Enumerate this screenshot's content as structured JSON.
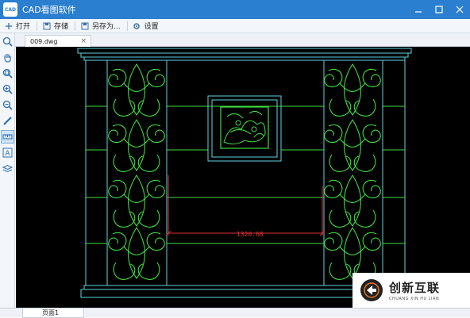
{
  "window": {
    "title": "CAD看图软件",
    "logo_text": "CAD",
    "minimize_icon": "minimize-icon",
    "maximize_icon": "maximize-icon",
    "close_icon": "close-icon"
  },
  "toolbar": {
    "items": [
      {
        "label": "打开",
        "icon": "plus-icon"
      },
      {
        "label": "存储",
        "icon": "save-icon"
      },
      {
        "label": "另存为...",
        "icon": "save-as-icon"
      },
      {
        "label": "设置",
        "icon": "gear-icon"
      }
    ]
  },
  "sidebar": {
    "tools": [
      {
        "icon": "zoom-window-icon"
      },
      {
        "icon": "pan-hand-icon"
      },
      {
        "icon": "zoom-extents-icon"
      },
      {
        "icon": "zoom-in-icon"
      },
      {
        "icon": "zoom-out-icon"
      },
      {
        "icon": "draw-pen-icon"
      },
      {
        "icon": "measure-icon",
        "active": true
      },
      {
        "icon": "text-icon"
      },
      {
        "icon": "layers-icon"
      }
    ]
  },
  "tabs": [
    {
      "label": "009.dwg",
      "close": "×"
    }
  ],
  "drawing": {
    "dimension_text": "1320.68",
    "colors": {
      "background": "#000000",
      "line_cyan": "#5fd3e0",
      "line_green": "#3fdc3f",
      "dimension_red": "#e03030"
    }
  },
  "pages": {
    "active": "页面1"
  },
  "watermark": {
    "main": "创新互联",
    "sub": "CHUANG XIN HU LIAN",
    "icon": "brand-logo-icon"
  },
  "colors": {
    "titlebar": "#2b7fd0"
  }
}
